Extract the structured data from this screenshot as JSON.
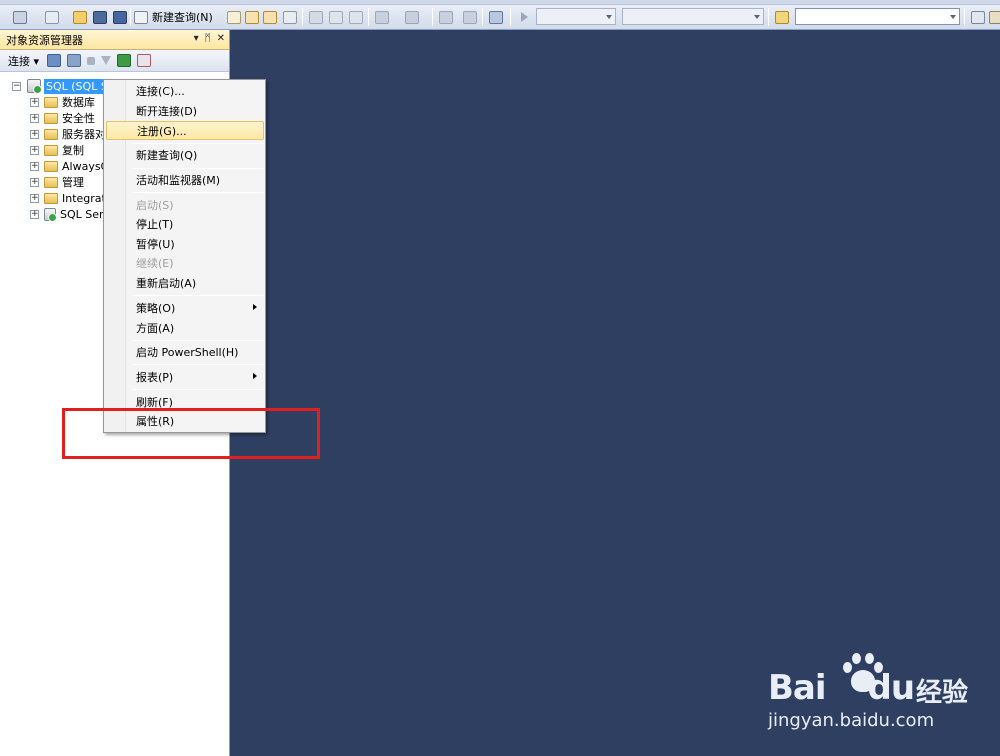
{
  "toolbar": {
    "new_query_label": "新建查询(N)"
  },
  "panel": {
    "title": "对象资源管理器",
    "title_buttons": [
      "▾",
      "ᛗ",
      "✕"
    ],
    "connect_label": "连接 ▾"
  },
  "tree": {
    "root": "SQL (SQL S",
    "items": [
      {
        "label": "数据库",
        "icon": "folder-icon"
      },
      {
        "label": "安全性",
        "icon": "folder-icon"
      },
      {
        "label": "服务器对",
        "icon": "folder-icon"
      },
      {
        "label": "复制",
        "icon": "folder-icon"
      },
      {
        "label": "AlwaysO",
        "icon": "folder-icon"
      },
      {
        "label": "管理",
        "icon": "folder-icon"
      },
      {
        "label": "Integrat",
        "icon": "folder-icon"
      },
      {
        "label": "SQL Ser",
        "icon": "sql-agent-icon"
      }
    ]
  },
  "context_menu": {
    "items": [
      {
        "label": "连接(C)...",
        "disabled": false,
        "highlighted": false,
        "submenu": false
      },
      {
        "label": "断开连接(D)",
        "disabled": false,
        "highlighted": false,
        "submenu": false
      },
      {
        "label": "注册(G)...",
        "disabled": false,
        "highlighted": true,
        "submenu": false
      },
      {
        "label": "新建查询(Q)",
        "disabled": false,
        "highlighted": false,
        "submenu": false
      },
      {
        "label": "活动和监视器(M)",
        "disabled": false,
        "highlighted": false,
        "submenu": false
      },
      {
        "label": "启动(S)",
        "disabled": true,
        "highlighted": false,
        "submenu": false
      },
      {
        "label": "停止(T)",
        "disabled": false,
        "highlighted": false,
        "submenu": false
      },
      {
        "label": "暂停(U)",
        "disabled": false,
        "highlighted": false,
        "submenu": false
      },
      {
        "label": "继续(E)",
        "disabled": true,
        "highlighted": false,
        "submenu": false
      },
      {
        "label": "重新启动(A)",
        "disabled": false,
        "highlighted": false,
        "submenu": false
      },
      {
        "label": "策略(O)",
        "disabled": false,
        "highlighted": false,
        "submenu": true
      },
      {
        "label": "方面(A)",
        "disabled": false,
        "highlighted": false,
        "submenu": false
      },
      {
        "label": "启动 PowerShell(H)",
        "disabled": false,
        "highlighted": false,
        "submenu": false
      },
      {
        "label": "报表(P)",
        "disabled": false,
        "highlighted": false,
        "submenu": true
      },
      {
        "label": "刷新(F)",
        "disabled": false,
        "highlighted": false,
        "submenu": false
      },
      {
        "label": "属性(R)",
        "disabled": false,
        "highlighted": false,
        "submenu": false
      }
    ]
  },
  "watermark": {
    "brand": "Bai",
    "brand_suffix": "du",
    "brand_cn": "经验",
    "url": "jingyan.baidu.com"
  },
  "colors": {
    "background": "#2e3f62",
    "highlight_box": "#e11f1f",
    "selection": "#3399ff"
  }
}
